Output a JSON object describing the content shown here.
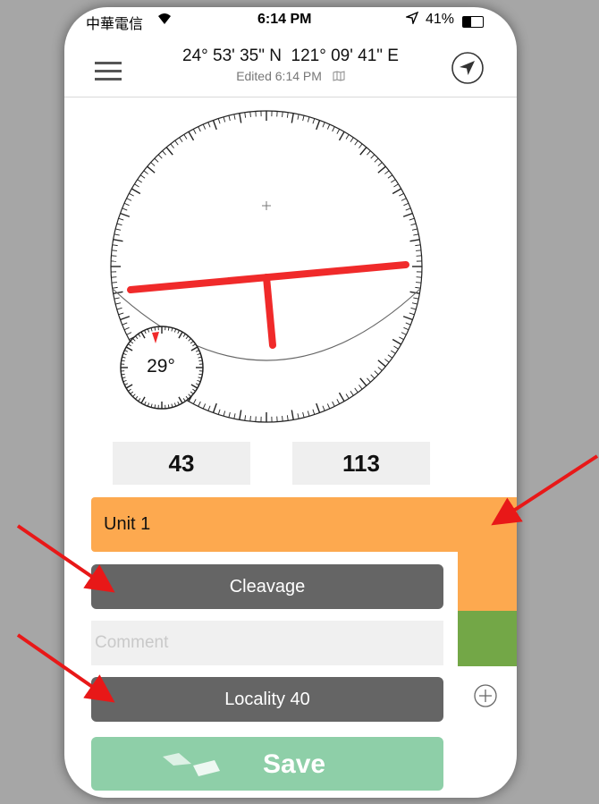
{
  "status_bar": {
    "carrier": "中華電信",
    "wifi_icon": "wifi-icon",
    "time": "6:14 PM",
    "location_icon": "location-arrow-icon",
    "battery_percent": "41%"
  },
  "header": {
    "latitude": "24° 53' 35\" N",
    "longitude": "121° 09' 41\" E",
    "edited": "Edited 6:14 PM",
    "map_icon": "map-icon",
    "menu_icon": "hamburger-menu-icon",
    "navigation_icon": "navigation-arrow-icon"
  },
  "compass": {
    "dip_angle": "29°",
    "strike_line_color": "#f02a2a"
  },
  "readouts": {
    "left": "43",
    "right": "113"
  },
  "unit": {
    "label": "Unit 1",
    "color": "#fda94f",
    "secondary_color": "#73a747"
  },
  "form": {
    "type_button": "Cleavage",
    "comment_placeholder": "Comment",
    "comment_value": "",
    "locality_button": "Locality 40",
    "add_icon": "plus-circle-icon",
    "save_label": "Save",
    "save_color": "#8ecfa8"
  },
  "annotation_arrow_color": "#e81818"
}
